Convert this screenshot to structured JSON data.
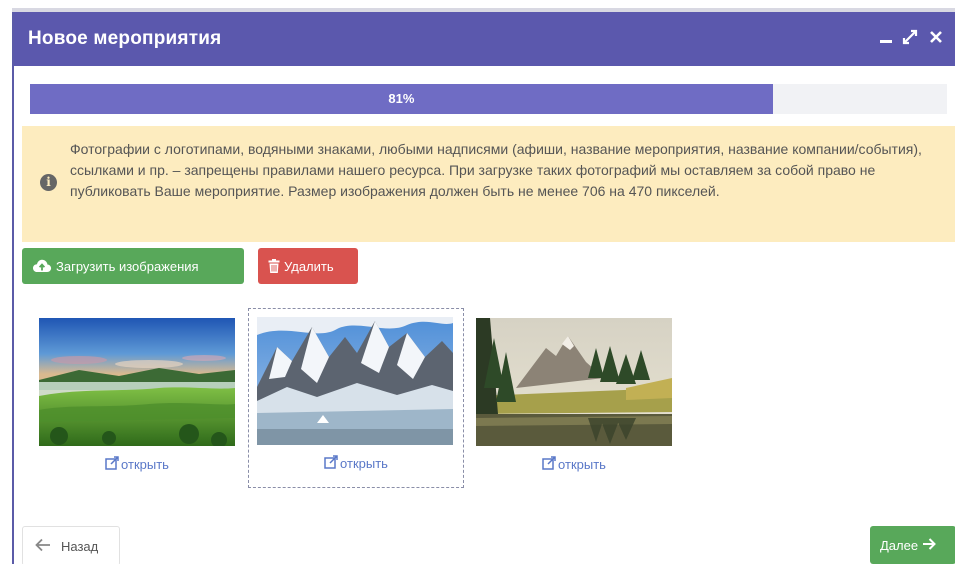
{
  "window": {
    "title": "Новое мероприятия",
    "controls": [
      "minimize-icon",
      "maximize-icon",
      "close-icon"
    ]
  },
  "progress": {
    "value": 0.81,
    "label": "81%"
  },
  "alert": {
    "icon": "info-icon",
    "text": "Фотографии с логотипами, водяными знаками, любыми надписями (афиши, название мероприятия, название компании/события), ссылками и пр. – запрещены правилами нашего ресурса. При загрузке таких фотографий мы оставляем за собой право не публиковать Ваше мероприятие. Размер изображения должен быть не менее 706 на 470 пикселей."
  },
  "toolbar": {
    "upload_label": "Загрузить изображения",
    "upload_icon": "cloud-upload-icon",
    "delete_label": "Удалить",
    "delete_icon": "trash-icon"
  },
  "gallery": {
    "items": [
      {
        "image": "green-valley-landscape",
        "open_label": "открыть",
        "selected": false
      },
      {
        "image": "snowy-mountain-peaks",
        "open_label": "открыть",
        "selected": true
      },
      {
        "image": "mountain-lake-forest",
        "open_label": "открыть",
        "selected": false
      }
    ]
  },
  "footer": {
    "back_label": "Назад",
    "next_label": "Далее"
  },
  "colors": {
    "header": "#5b58ad",
    "progress": "#6f6cc4",
    "alert_bg": "#fdecbf",
    "success": "#58a85a",
    "danger": "#d9534f",
    "link": "#5a78c8"
  }
}
